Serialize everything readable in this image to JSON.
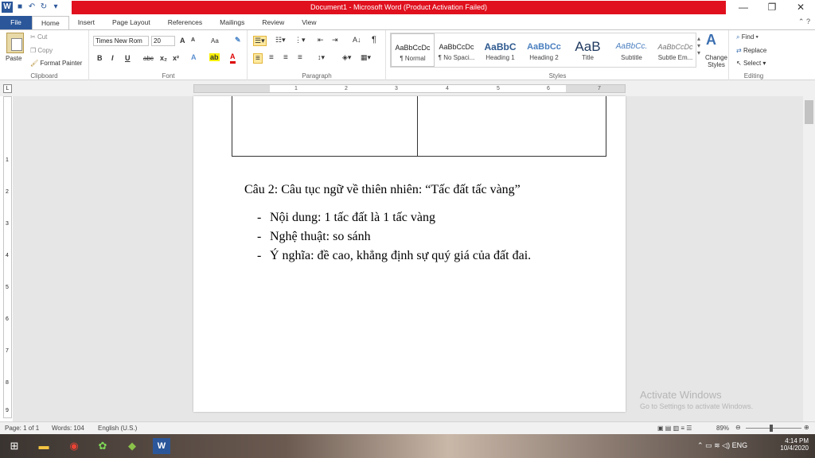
{
  "window": {
    "title": "Document1 - Microsoft Word (Product Activation Failed)",
    "min_glyph": "—",
    "max_glyph": "❐",
    "close_glyph": "✕"
  },
  "tabs": [
    "File",
    "Home",
    "Insert",
    "Page Layout",
    "References",
    "Mailings",
    "Review",
    "View"
  ],
  "ribbon": {
    "clipboard": {
      "paste": "Paste",
      "cut": "Cut",
      "copy": "Copy",
      "format_painter": "Format Painter",
      "label": "Clipboard"
    },
    "font": {
      "font_name": "Times New Rom",
      "font_size": "20",
      "label": "Font",
      "bold": "B",
      "italic": "I",
      "underline": "U",
      "strike": "abc",
      "grow": "A",
      "shrink": "A",
      "change_case": "Aa"
    },
    "paragraph": {
      "label": "Paragraph",
      "sort": "A↓",
      "pilcrow": "¶"
    },
    "styles": {
      "label": "Styles",
      "items": [
        {
          "sample": "AaBbCcDc",
          "name": "¶ Normal"
        },
        {
          "sample": "AaBbCcDc",
          "name": "¶ No Spaci..."
        },
        {
          "sample": "AaBbC",
          "name": "Heading 1"
        },
        {
          "sample": "AaBbCc",
          "name": "Heading 2"
        },
        {
          "sample": "AaB",
          "name": "Title"
        },
        {
          "sample": "AaBbCc.",
          "name": "Subtitle"
        },
        {
          "sample": "AaBbCcDc",
          "name": "Subtle Em..."
        }
      ],
      "change_styles": "Change Styles"
    },
    "editing": {
      "label": "Editing",
      "find": "Find",
      "replace": "Replace",
      "select": "Select"
    }
  },
  "ruler": {
    "ticks": [
      "1",
      "2",
      "3",
      "4",
      "5",
      "6",
      "7"
    ],
    "vticks": [
      "1",
      "2",
      "3",
      "4",
      "5",
      "6",
      "7",
      "8",
      "9"
    ]
  },
  "document": {
    "heading": "Câu 2: Câu tục ngữ về thiên nhiên: “Tấc đất tấc vàng”",
    "bullets": [
      "Nội dung: 1 tấc đất là 1 tấc vàng",
      "Nghệ thuật: so sánh",
      "Ý nghĩa: đề cao, khẳng định sự quý giá của đất đai."
    ]
  },
  "watermark": {
    "line1": "Activate Windows",
    "line2": "Go to Settings to activate Windows."
  },
  "status": {
    "page": "Page: 1 of 1",
    "words": "Words: 104",
    "language": "English (U.S.)",
    "zoom": "89%",
    "zoom_fraction": 0.45
  },
  "taskbar": {
    "lang": "ENG",
    "time": "4:14 PM",
    "date": "10/4/2020"
  }
}
